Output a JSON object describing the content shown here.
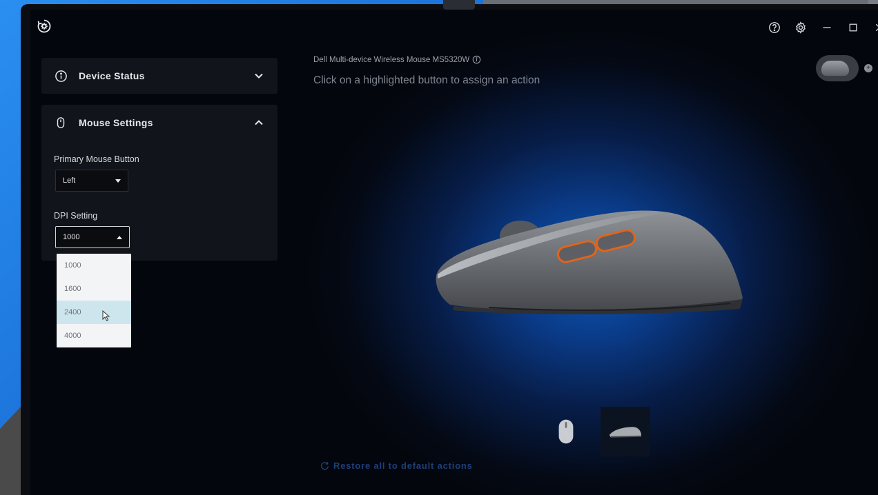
{
  "window": {
    "controls": [
      "help-icon",
      "settings-icon",
      "minimize-icon",
      "maximize-icon",
      "close-icon"
    ]
  },
  "sidebar": {
    "device_status": {
      "title": "Device Status",
      "icon": "info-icon",
      "expanded": false
    },
    "mouse_settings": {
      "title": "Mouse Settings",
      "icon": "mouse-icon",
      "expanded": true,
      "primary_button": {
        "label": "Primary Mouse Button",
        "value": "Left"
      },
      "dpi": {
        "label": "DPI Setting",
        "value": "1000",
        "options": [
          "1000",
          "1600",
          "2400",
          "4000"
        ],
        "highlighted": "2400"
      }
    }
  },
  "main": {
    "device_name": "Dell Multi-device Wireless Mouse MS5320W",
    "hint": "Click on a highlighted button to assign an action",
    "restore_label": "Restore all to default actions"
  },
  "colors": {
    "accent_orange": "#e0641c",
    "dropdown_highlight": "#cde6ee",
    "restore_text": "#1f3f7a"
  }
}
